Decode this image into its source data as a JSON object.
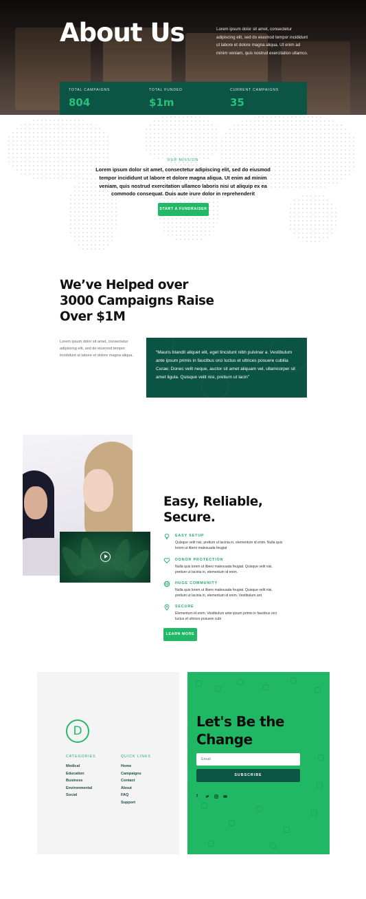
{
  "hero": {
    "title": "About Us",
    "text": "Lorem ipsum dolor sit amet, consectetur adipiscing elit, sed do eiusmod tempor incididunt ut labore et dolore magna aliqua. Ut enim ad minim veniam, quis nostrud exercitation ullamco.",
    "stats": [
      {
        "label": "TOTAL CAMPAIGNS",
        "value": "804"
      },
      {
        "label": "TOTAL FUNDED",
        "value": "$1m"
      },
      {
        "label": "CURRENT CAMPAIGNS",
        "value": "35"
      }
    ]
  },
  "mission": {
    "label": "OUR MISSION",
    "text": "Lorem ipsum dolor sit amet, consectetur adipiscing elit, sed do eiusmod tempor incididunt ut labore et dolore magna aliqua. Ut enim ad minim veniam, quis nostrud exercitation ullamco laboris nisi ut aliquip ex ea commodo consequat. Duis aute irure dolor in reprehenderit",
    "button": "START A FUNDRAISER"
  },
  "helped": {
    "title": "We’ve Helped over 3000 Campaigns Raise Over $1M",
    "text": "Lorem ipsum dolor sit amet, consectetur adipiscing elit, sed do eiusmod tempor incididunt ut labore et dolore magna aliqua.",
    "quote": "“Mauris blandit aliquet elit, eget tincidunt nibh pulvinar a. Vestibulum ante ipsum primis in faucibus orci luctus et ultrices posuere cubilia Curae; Donec velit neque, auctor sit amet aliquam vel, ullamcorper sit amet ligula. Quisque velit nisi, pretium ut lacin”"
  },
  "easy": {
    "title": "Easy, Reliable, Secure.",
    "features": [
      {
        "icon": "lightbulb-icon",
        "title": "EASY SETUP",
        "text": "Quisque velit nisi, pretium ut lacinia in, elementum id enim. Nulla quis lorem ut libero malesuada feugiat"
      },
      {
        "icon": "heart-icon",
        "title": "DONOR PROTECTION",
        "text": "Nulla quis lorem ut libero malesuada feugiat. Quisque velit nisi, pretium ut lacinia in, elementum id enim."
      },
      {
        "icon": "globe-icon",
        "title": "HUGE COMMUNITY",
        "text": "Nulla quis lorem ut libero malesuada feugiat. Quisque velit nisi, pretium ut lacinia in, elementum id enim. Vestibulum ant"
      },
      {
        "icon": "location-pin-icon",
        "title": "SECURE",
        "text": "Elementum id enim. Vestibulum ante ipsum primis in faucibus orci luctus et ultrices posuere cubi"
      }
    ],
    "button": "LEARN MORE"
  },
  "footer": {
    "logo_letter": "D",
    "categories_head": "CATEGORIES",
    "categories": [
      "Medical",
      "Education",
      "Business",
      "Environmental",
      "Social"
    ],
    "quicklinks_head": "QUICK LINKS",
    "quicklinks": [
      "Home",
      "Campaigns",
      "Contact",
      "About",
      "FAQ",
      "Support"
    ],
    "cta_title": "Let's Be the Change",
    "email_placeholder": "Email",
    "subscribe": "SUBSCRIBE",
    "social": [
      "f",
      "t",
      "ig",
      "yt"
    ]
  },
  "colors": {
    "accent": "#21b868",
    "dark_green": "#0c5443"
  }
}
